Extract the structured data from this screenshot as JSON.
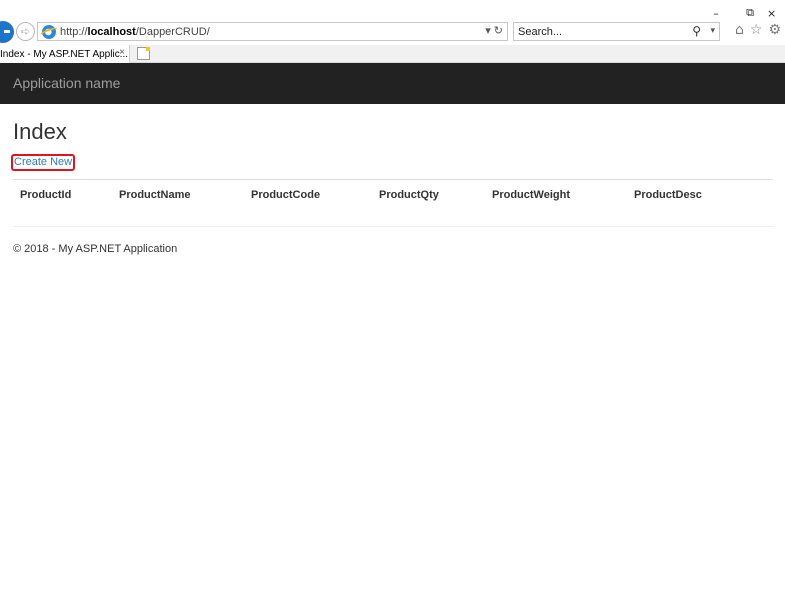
{
  "window": {
    "minimize": "–",
    "restore": "⧉",
    "close": "×"
  },
  "browser": {
    "url_prefix": "http://",
    "url_host": "localhost",
    "url_path": "/DapperCRUD/",
    "address_actions": "▾ ↻",
    "search_placeholder": "Search...",
    "tab_title": "Index - My ASP.NET Applic...",
    "tab_close": "×"
  },
  "navbar": {
    "brand": "Application name"
  },
  "page": {
    "title": "Index",
    "create_link": "Create New",
    "columns": [
      "ProductId",
      "ProductName",
      "ProductCode",
      "ProductQty",
      "ProductWeight",
      "ProductDesc"
    ],
    "rows": [],
    "footer": "© 2018 - My ASP.NET Application"
  },
  "colors": {
    "navbar_bg": "#222222",
    "brand_text": "#9d9d9d",
    "link": "#337ab7",
    "highlight_border": "#e0141e"
  },
  "icons": {
    "back": "back-arrow-icon",
    "forward": "forward-arrow-icon",
    "browser": "ie-logo-icon",
    "search": "search-icon",
    "home": "home-icon",
    "favorites": "star-icon",
    "settings": "gear-icon",
    "new_tab": "new-tab-icon"
  }
}
